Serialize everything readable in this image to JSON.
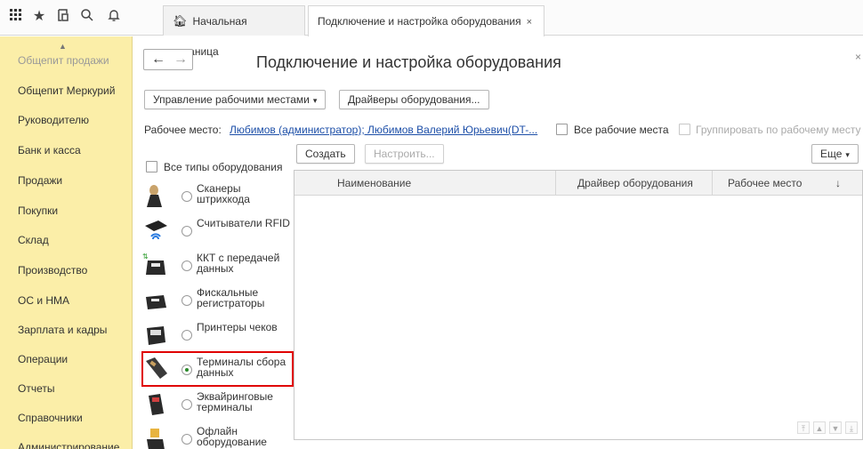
{
  "topbar": {
    "apps_icon": "apps-grid-icon",
    "favorites_icon": "star-icon",
    "history_icon": "history-icon",
    "search_icon": "search-icon",
    "notifications_icon": "bell-icon",
    "tabs": [
      {
        "label": "Начальная страница",
        "icon": "home-icon"
      },
      {
        "label": "Подключение и настройка оборудования",
        "close": "×"
      }
    ]
  },
  "sidebar": {
    "items": [
      "Общепит продажи",
      "Общепит Меркурий",
      "Руководителю",
      "Банк и касса",
      "Продажи",
      "Покупки",
      "Склад",
      "Производство",
      "ОС и НМА",
      "Зарплата и кадры",
      "Операции",
      "Отчеты",
      "Справочники",
      "Администрирование"
    ]
  },
  "page": {
    "back": "←",
    "forward": "→",
    "title": "Подключение и настройка оборудования",
    "close": "×"
  },
  "toolbar": {
    "workplaces_label": "Управление рабочими местами",
    "drivers_label": "Драйверы оборудования..."
  },
  "workplace": {
    "label": "Рабочее место:",
    "value": "Любимов (администратор); Любимов Валерий Юрьевич(DT-...",
    "all_label": "Все рабочие места",
    "group_label": "Группировать по рабочему месту"
  },
  "equipment": {
    "all_types_label": "Все типы оборудования",
    "types": [
      {
        "label": "Сканеры штрихкода",
        "icon": "barcode-scanner-icon",
        "selected": false
      },
      {
        "label": "Считыватели RFID",
        "icon": "rfid-reader-icon",
        "selected": false
      },
      {
        "label": "ККТ с передачей данных",
        "icon": "kkt-icon",
        "selected": false
      },
      {
        "label": "Фискальные регистраторы",
        "icon": "fiscal-registrar-icon",
        "selected": false
      },
      {
        "label": "Принтеры чеков",
        "icon": "receipt-printer-icon",
        "selected": false
      },
      {
        "label": "Терминалы сбора данных",
        "icon": "data-terminal-icon",
        "selected": true
      },
      {
        "label": "Эквайринговые терминалы",
        "icon": "acquiring-terminal-icon",
        "selected": false
      },
      {
        "label": "Офлайн оборудование",
        "icon": "offline-equipment-icon",
        "selected": false
      }
    ]
  },
  "table": {
    "create_label": "Создать",
    "configure_label": "Настроить...",
    "more_label": "Еще",
    "columns": [
      "Наименование",
      "Драйвер оборудования",
      "Рабочее место"
    ],
    "sort_icon": "↓",
    "rows": []
  },
  "colors": {
    "sidebar_bg": "#fbeea8",
    "link": "#1d4fa8",
    "highlight": "#e00000"
  }
}
